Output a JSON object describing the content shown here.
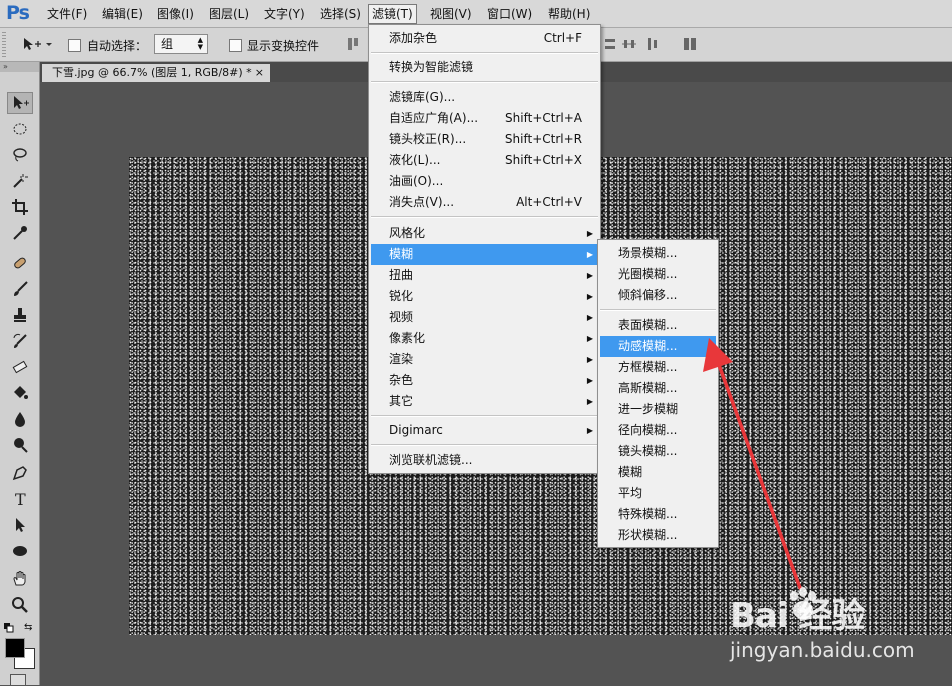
{
  "app": {
    "logo": "Ps"
  },
  "menubar": {
    "items": [
      "文件(F)",
      "编辑(E)",
      "图像(I)",
      "图层(L)",
      "文字(Y)",
      "选择(S)",
      "滤镜(T)",
      "视图(V)",
      "窗口(W)",
      "帮助(H)"
    ],
    "active": "滤镜(T)"
  },
  "options": {
    "auto_select_label": "自动选择：",
    "group_value": "组",
    "show_transform_label": "显示变换控件"
  },
  "document": {
    "tab_title": "下雪.jpg @ 66.7% (图层 1, RGB/8#) *",
    "close": "×"
  },
  "filter_menu": {
    "items": [
      {
        "label": "添加杂色",
        "shortcut": "Ctrl+F"
      },
      {
        "label": "转换为智能滤镜"
      },
      {
        "label": "滤镜库(G)..."
      },
      {
        "label": "自适应广角(A)...",
        "shortcut": "Shift+Ctrl+A"
      },
      {
        "label": "镜头校正(R)...",
        "shortcut": "Shift+Ctrl+R"
      },
      {
        "label": "液化(L)...",
        "shortcut": "Shift+Ctrl+X"
      },
      {
        "label": "油画(O)..."
      },
      {
        "label": "消失点(V)...",
        "shortcut": "Alt+Ctrl+V"
      },
      {
        "label": "风格化"
      },
      {
        "label": "模糊"
      },
      {
        "label": "扭曲"
      },
      {
        "label": "锐化"
      },
      {
        "label": "视频"
      },
      {
        "label": "像素化"
      },
      {
        "label": "渲染"
      },
      {
        "label": "杂色"
      },
      {
        "label": "其它"
      },
      {
        "label": "Digimarc"
      },
      {
        "label": "浏览联机滤镜..."
      }
    ],
    "highlighted": "模糊"
  },
  "blur_menu": {
    "items": [
      "场景模糊...",
      "光圈模糊...",
      "倾斜偏移...",
      "表面模糊...",
      "动感模糊...",
      "方框模糊...",
      "高斯模糊...",
      "进一步模糊",
      "径向模糊...",
      "镜头模糊...",
      "模糊",
      "平均",
      "特殊模糊...",
      "形状模糊..."
    ],
    "highlighted": "动感模糊..."
  },
  "watermark": {
    "brand": "Bai 经验",
    "url": "jingyan.baidu.com"
  },
  "colors": {
    "highlight": "#3f99ef",
    "arrow": "#e8373a",
    "logo": "#2a6bbf"
  }
}
